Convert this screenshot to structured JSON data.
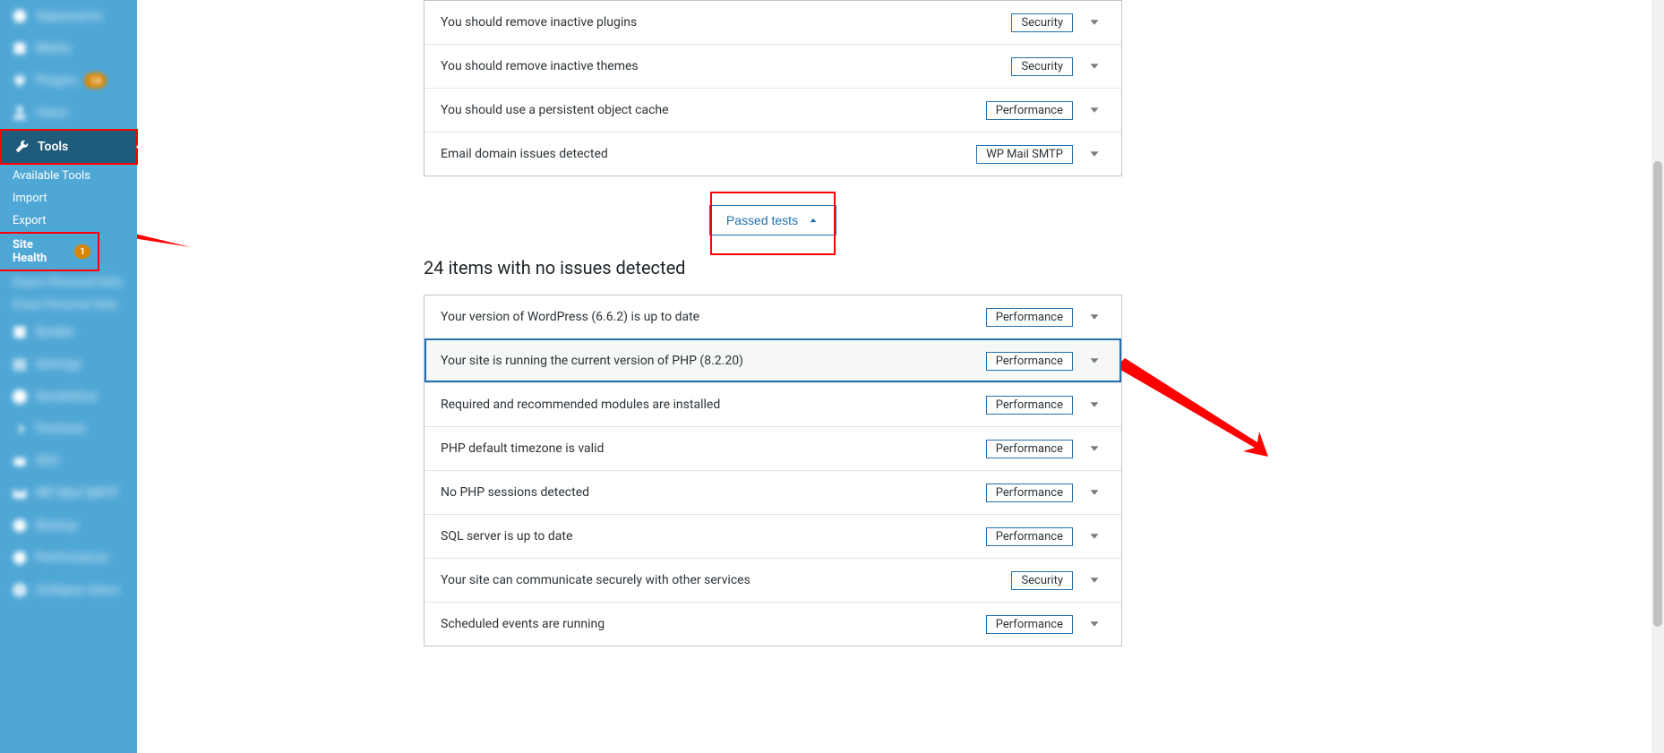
{
  "sidebar": {
    "items": [
      {
        "label": "Appearance",
        "blur": true
      },
      {
        "label": "Media",
        "blur": true
      },
      {
        "label": "Plugins",
        "blur": true,
        "count": 14
      },
      {
        "label": "Users",
        "blur": true
      },
      {
        "label": "Tools",
        "current": true
      },
      {
        "label": "Builder",
        "blur": true
      },
      {
        "label": "Settings",
        "blur": true
      },
      {
        "label": "Sendinblue",
        "blur": true
      },
      {
        "label": "Premium",
        "blur": true
      },
      {
        "label": "SEO",
        "blur": true
      },
      {
        "label": "WP Mail SMTP",
        "blur": true
      },
      {
        "label": "Backup",
        "blur": true
      },
      {
        "label": "Performance",
        "blur": true
      },
      {
        "label": "Collapse menu",
        "blur": true
      }
    ],
    "plugins_count": "14",
    "tools_label": "Tools",
    "submenu": [
      {
        "label": "Available Tools"
      },
      {
        "label": "Import"
      },
      {
        "label": "Export"
      },
      {
        "label": "Site Health",
        "active": true,
        "count": "1"
      },
      {
        "label": "Export Personal Data",
        "blur": true
      },
      {
        "label": "Erase Personal Data",
        "blur": true
      }
    ]
  },
  "recommended": [
    {
      "title": "You should remove inactive plugins",
      "badge": "Security"
    },
    {
      "title": "You should remove inactive themes",
      "badge": "Security"
    },
    {
      "title": "You should use a persistent object cache",
      "badge": "Performance"
    },
    {
      "title": "Email domain issues detected",
      "badge": "WP Mail SMTP"
    }
  ],
  "passed_label": "Passed tests",
  "passed_heading": "24 items with no issues detected",
  "passed": [
    {
      "title": "Your version of WordPress (6.6.2) is up to date",
      "badge": "Performance"
    },
    {
      "title": "Your site is running the current version of PHP (8.2.20)",
      "badge": "Performance",
      "highlight": true
    },
    {
      "title": "Required and recommended modules are installed",
      "badge": "Performance"
    },
    {
      "title": "PHP default timezone is valid",
      "badge": "Performance"
    },
    {
      "title": "No PHP sessions detected",
      "badge": "Performance"
    },
    {
      "title": "SQL server is up to date",
      "badge": "Performance"
    },
    {
      "title": "Your site can communicate securely with other services",
      "badge": "Security"
    },
    {
      "title": "Scheduled events are running",
      "badge": "Performance"
    }
  ]
}
